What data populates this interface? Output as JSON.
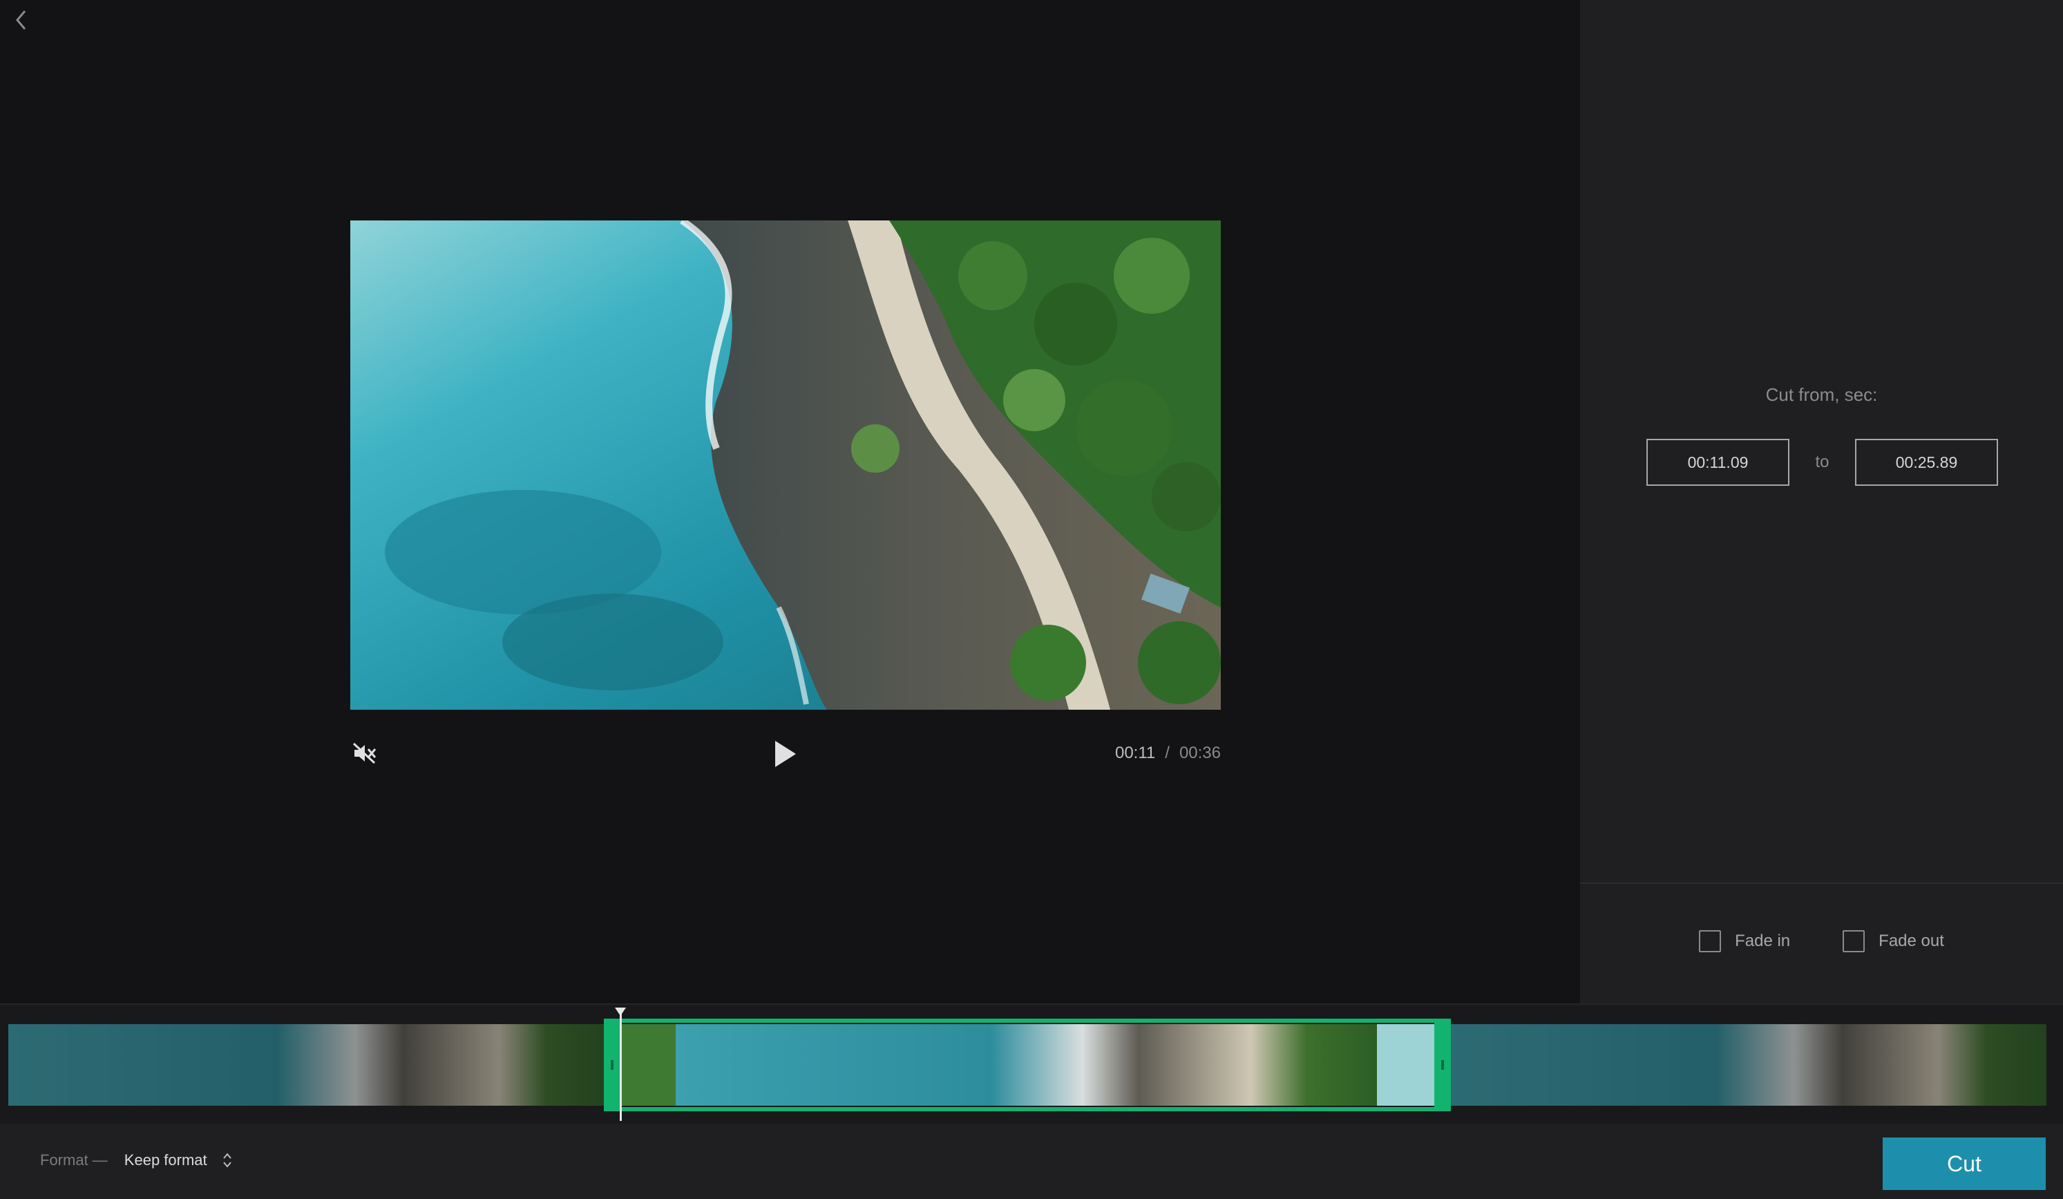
{
  "player": {
    "current_time": "00:11",
    "separator": "/",
    "total_time": "00:36"
  },
  "cut_panel": {
    "label": "Cut from, sec:",
    "start_value": "00:11.09",
    "to_label": "to",
    "end_value": "00:25.89",
    "fade_in_label": "Fade in",
    "fade_out_label": "Fade out",
    "fade_in_checked": false,
    "fade_out_checked": false
  },
  "timeline": {
    "selection_start_fraction": 0.308,
    "selection_end_fraction": 0.719,
    "playhead_fraction": 0.308,
    "selection_color": "#12b36f"
  },
  "bottom_bar": {
    "format_label": "Format —",
    "format_value": "Keep format",
    "cut_button_label": "Cut"
  },
  "colors": {
    "accent": "#1d8fac",
    "selection": "#12b36f",
    "background": "#131315",
    "panel": "#1f1f21"
  },
  "icons": {
    "back": "chevron-left-icon",
    "mute": "muted-speaker-icon",
    "play": "play-icon",
    "format_select": "up-down-chevron-icon"
  }
}
